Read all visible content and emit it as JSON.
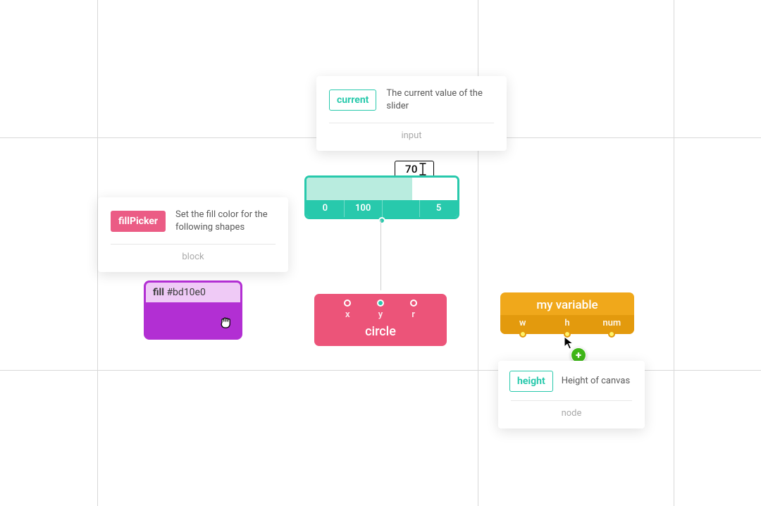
{
  "tooltips": {
    "current": {
      "badge": "current",
      "desc": "The current value of the slider",
      "footer": "input"
    },
    "fillPicker": {
      "badge": "fillPicker",
      "desc": "Set the fill color for the following shapes",
      "footer": "block"
    },
    "height": {
      "badge": "height",
      "desc": "Height of canvas",
      "footer": "node"
    }
  },
  "slider": {
    "value": "70",
    "params": {
      "min": "0",
      "max": "100",
      "empty": "",
      "step": "5"
    }
  },
  "fillBlock": {
    "label": "fill",
    "color": "#bd10e0"
  },
  "circleNode": {
    "title": "circle",
    "inputs": {
      "x": "x",
      "y": "y",
      "r": "r"
    }
  },
  "varNode": {
    "title": "my variable",
    "outputs": {
      "w": "w",
      "h": "h",
      "num": "num"
    }
  },
  "plus": "+"
}
